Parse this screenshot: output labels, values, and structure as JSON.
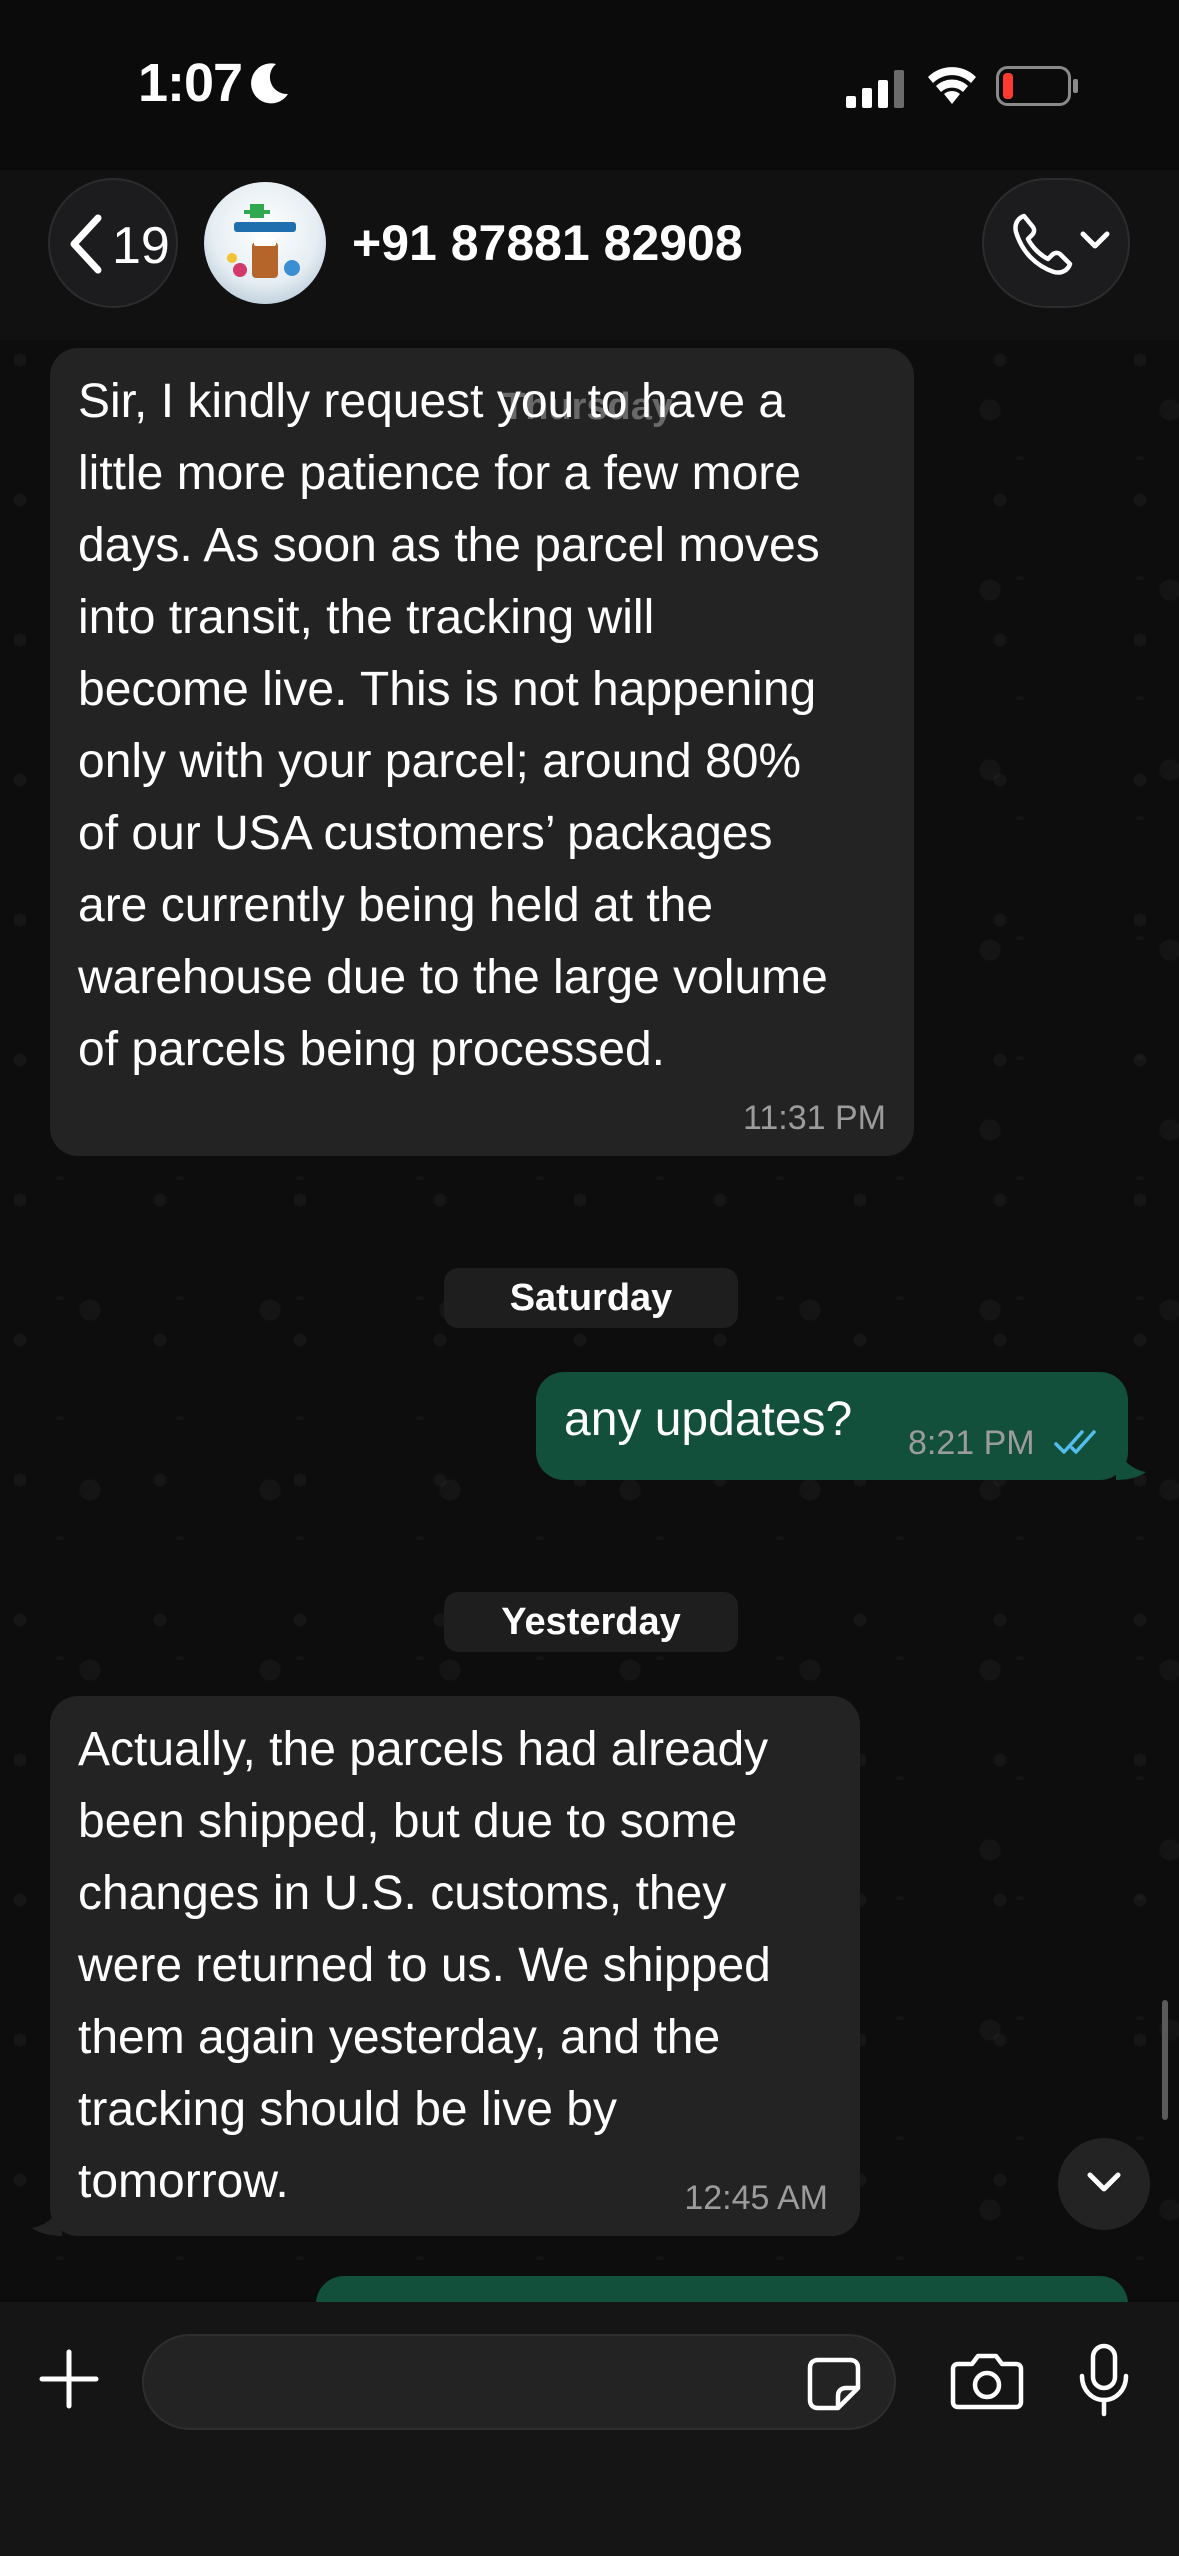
{
  "status_bar": {
    "time": "1:07"
  },
  "header": {
    "back_count": "19",
    "contact_name": "+91 87881 82908"
  },
  "messages": [
    {
      "direction": "incoming",
      "text": "Sir, I kindly request you to have a\nlittle more patience for a few more\ndays. As soon as the parcel moves\ninto transit, the tracking will\nbecome live. This is not happening\nonly with your parcel; around 80%\nof our USA customers’ packages\nare currently being held at the\nwarehouse due to the large volume\nof parcels being processed.",
      "time": "11:31 PM"
    },
    {
      "direction": "outgoing",
      "text": "any updates?",
      "time": "8:21 PM",
      "read": true
    },
    {
      "direction": "incoming",
      "text": "Actually, the parcels had already\nbeen shipped, but due to some\nchanges in U.S. customs, they\nwere returned to us. We shipped\nthem again yesterday, and the\ntracking should be live by\ntomorrow.",
      "time": "12:45 AM"
    }
  ],
  "date_separators": {
    "ghost": "Thursday",
    "first": "Saturday",
    "second": "Yesterday"
  },
  "colors": {
    "incoming_bubble": "#232323",
    "outgoing_bubble": "#12503b",
    "read_ticks": "#53bdeb",
    "battery_low": "#ff3b30"
  },
  "icons": [
    "moon-icon",
    "signal-icon",
    "wifi-icon",
    "battery-icon",
    "chevron-left-icon",
    "phone-icon",
    "chevron-down-icon",
    "double-check-icon",
    "plus-icon",
    "sticker-icon",
    "camera-icon",
    "mic-icon"
  ]
}
